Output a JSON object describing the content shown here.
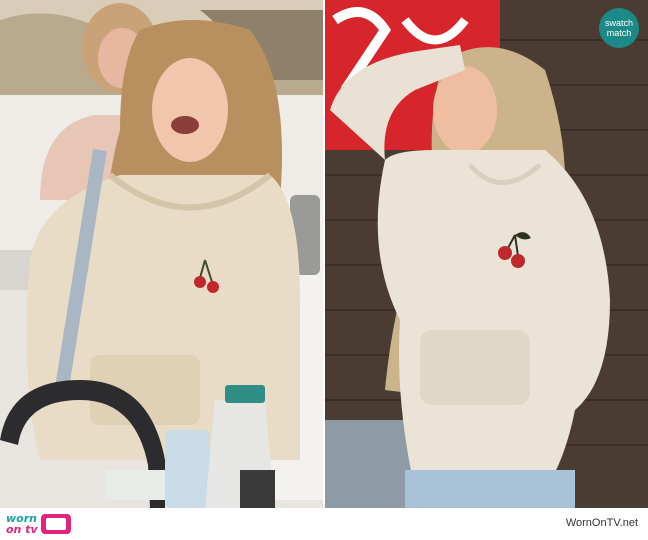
{
  "badge": {
    "line1": "swatch",
    "line2": "match"
  },
  "footer": {
    "logo_line1": "worn",
    "logo_line2": "on tv",
    "site": "WornOnTV.net"
  },
  "colors": {
    "hoodie": "#e9dcc6",
    "badge_teal": "#1b8a86",
    "brand_pink": "#e0267a",
    "brand_teal": "#1aa0a8",
    "sign_red": "#d7262b"
  },
  "images": {
    "left": "woman in cream hoodie with cherry embroidery in kitchen",
    "right": "woman in cream hoodie with cherry embroidery outdoors"
  }
}
